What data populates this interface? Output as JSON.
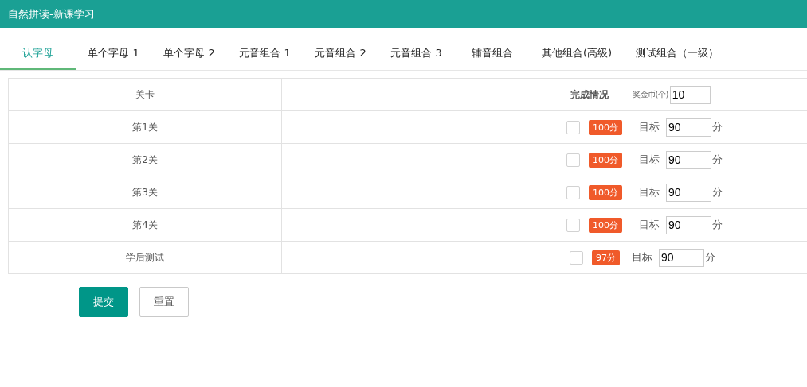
{
  "window": {
    "title": "自然拼读-新课学习"
  },
  "tabs": [
    {
      "label": "认字母",
      "selected": true
    },
    {
      "label": "单个字母 1",
      "selected": false
    },
    {
      "label": "单个字母 2",
      "selected": false
    },
    {
      "label": "元音组合 1",
      "selected": false
    },
    {
      "label": "元音组合 2",
      "selected": false
    },
    {
      "label": "元音组合 3",
      "selected": false
    },
    {
      "label": "辅音组合",
      "selected": false
    },
    {
      "label": "其他组合(高级)",
      "selected": false
    },
    {
      "label": "测试组合（一级）",
      "selected": false
    }
  ],
  "table": {
    "columns": [
      "关卡",
      "完成情况"
    ],
    "reward": {
      "label": "奖金币(个)",
      "value": "10"
    },
    "rows": [
      {
        "level": "第1关",
        "checked": false,
        "score": "100分",
        "target_label": "目标",
        "target": "90",
        "unit": "分"
      },
      {
        "level": "第2关",
        "checked": false,
        "score": "100分",
        "target_label": "目标",
        "target": "90",
        "unit": "分"
      },
      {
        "level": "第3关",
        "checked": false,
        "score": "100分",
        "target_label": "目标",
        "target": "90",
        "unit": "分"
      },
      {
        "level": "第4关",
        "checked": false,
        "score": "100分",
        "target_label": "目标",
        "target": "90",
        "unit": "分"
      },
      {
        "level": "学后测试",
        "checked": false,
        "score": "97分",
        "target_label": "目标",
        "target": "90",
        "unit": "分"
      }
    ]
  },
  "buttons": [
    {
      "label": "提交",
      "kind": "primary"
    },
    {
      "label": "重置",
      "kind": "secondary"
    }
  ]
}
